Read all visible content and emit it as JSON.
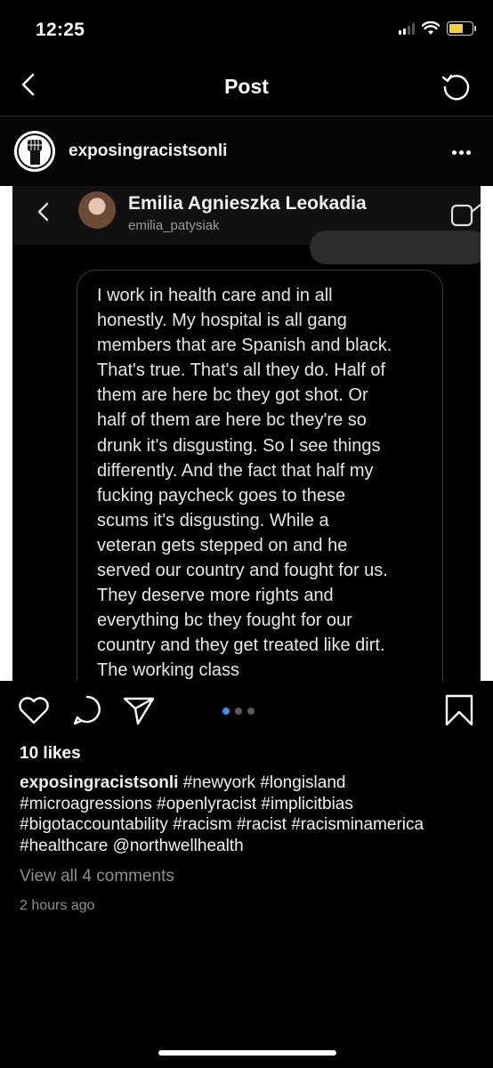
{
  "status_bar": {
    "time": "12:25"
  },
  "header": {
    "title": "Post"
  },
  "post": {
    "username": "exposingracistsonli",
    "image": {
      "dm_name": "Emilia Agnieszka Leokadia",
      "dm_handle": "emilia_patysiak",
      "message": "I work in health care and in all\nhonestly. My hospital is all gang\nmembers that are Spanish and black.\nThat's true. That's all they do. Half of\nthem are here bc they got shot.  Or\nhalf of them are here bc they're so\ndrunk it's disgusting. So I see things\ndifferently. And the fact that half my\nfucking paycheck goes to these\nscums it's disgusting. While a\nveteran gets stepped on and he\nserved our country and fought for us.\nThey deserve more rights and\neverything bc they fought for our\ncountry and they get treated like dirt.\nThe working class"
    },
    "carousel": {
      "count": 3,
      "active_index": 0
    },
    "likes": "10 likes",
    "caption_user": "exposingracistsonli",
    "caption_text": " #newyork #longisland #microagressions #openlyracist #implicitbias #bigotaccountability #racism #racist #racisminamerica #healthcare @northwellhealth",
    "view_comments": "View all 4 comments",
    "timestamp": "2 hours ago"
  },
  "icons": {
    "back": "chevron-left-icon",
    "refresh": "refresh-icon",
    "more": "more-horizontal-icon",
    "like": "heart-icon",
    "comment": "comment-icon",
    "share": "send-icon",
    "save": "bookmark-icon"
  },
  "colors": {
    "accent": "#3d8ef0",
    "background": "#000000",
    "muted_text": "#8e8e8e"
  }
}
